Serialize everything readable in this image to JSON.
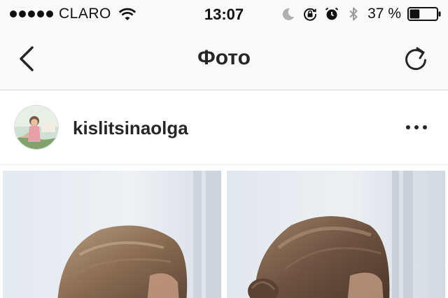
{
  "status_bar": {
    "carrier": "CLARO",
    "time": "13:07",
    "battery_percent": "37 %",
    "battery_level": 0.37,
    "icons": [
      "signal-dots",
      "wifi-icon",
      "moon-icon",
      "rotation-lock-icon",
      "alarm-icon",
      "bluetooth-icon",
      "battery-icon"
    ]
  },
  "nav": {
    "title": "Фото",
    "left_icon": "back-chevron-icon",
    "right_icon": "refresh-icon"
  },
  "post": {
    "username": "kislitsinaolga",
    "avatar_icon": "avatar",
    "more_icon": "more-options-icon"
  },
  "colors": {
    "bar_background": "#fafafa",
    "text": "#262626",
    "divider": "#d8d8d8"
  }
}
